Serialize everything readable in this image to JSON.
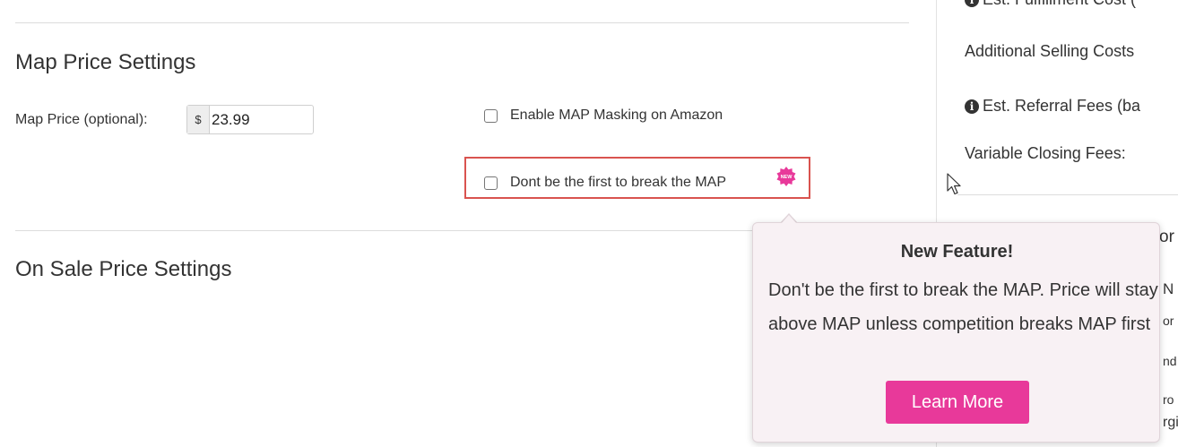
{
  "map_section": {
    "title": "Map Price Settings",
    "price_label": "Map Price (optional):",
    "currency": "$",
    "price_value": "23.99",
    "masking_checkbox_label": "Enable MAP Masking on Amazon",
    "masking_checked": false,
    "dont_break_checkbox_label": "Dont be the first to break the MAP",
    "dont_break_checked": false,
    "new_badge": "NEW"
  },
  "sale_section": {
    "title": "On Sale Price Settings"
  },
  "right_panel": {
    "fulfillment_label": "Est. Fulfillment Cost (",
    "additional_costs_label": "Additional Selling Costs",
    "referral_fees_label": "Est. Referral Fees (ba",
    "closing_fees_label": "Variable Closing Fees:",
    "fragments": [
      "or",
      "N",
      "or",
      "nd",
      "ro",
      "rgi"
    ]
  },
  "popover": {
    "title": "New Feature!",
    "body": "Don't be the first to break the MAP. Price will stay above MAP unless competition breaks MAP first",
    "button_label": "Learn More"
  },
  "colors": {
    "accent_pink": "#e8399a",
    "highlight_red": "#d9534f",
    "popover_bg": "#f8f1f4"
  }
}
